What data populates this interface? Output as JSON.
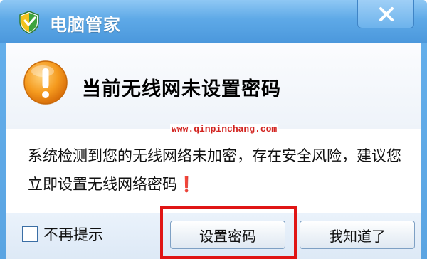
{
  "window": {
    "title": "电脑管家",
    "app_icon": "shield-icon",
    "close_icon": "close-icon"
  },
  "header": {
    "icon": "warning-icon",
    "text": "当前无线网未设置密码"
  },
  "watermark": "www.qinpinchang.com",
  "message": "系统检测到您的无线网络未加密，存在安全风险，建议您立即设置无线网络密码❗",
  "footer": {
    "checkbox_label": "不再提示",
    "checkbox_checked": false,
    "primary_button": "设置密码",
    "secondary_button": "我知道了"
  },
  "colors": {
    "title_bar": "#5ea9e7",
    "warning": "#f39a1e",
    "highlight": "#e01515"
  }
}
